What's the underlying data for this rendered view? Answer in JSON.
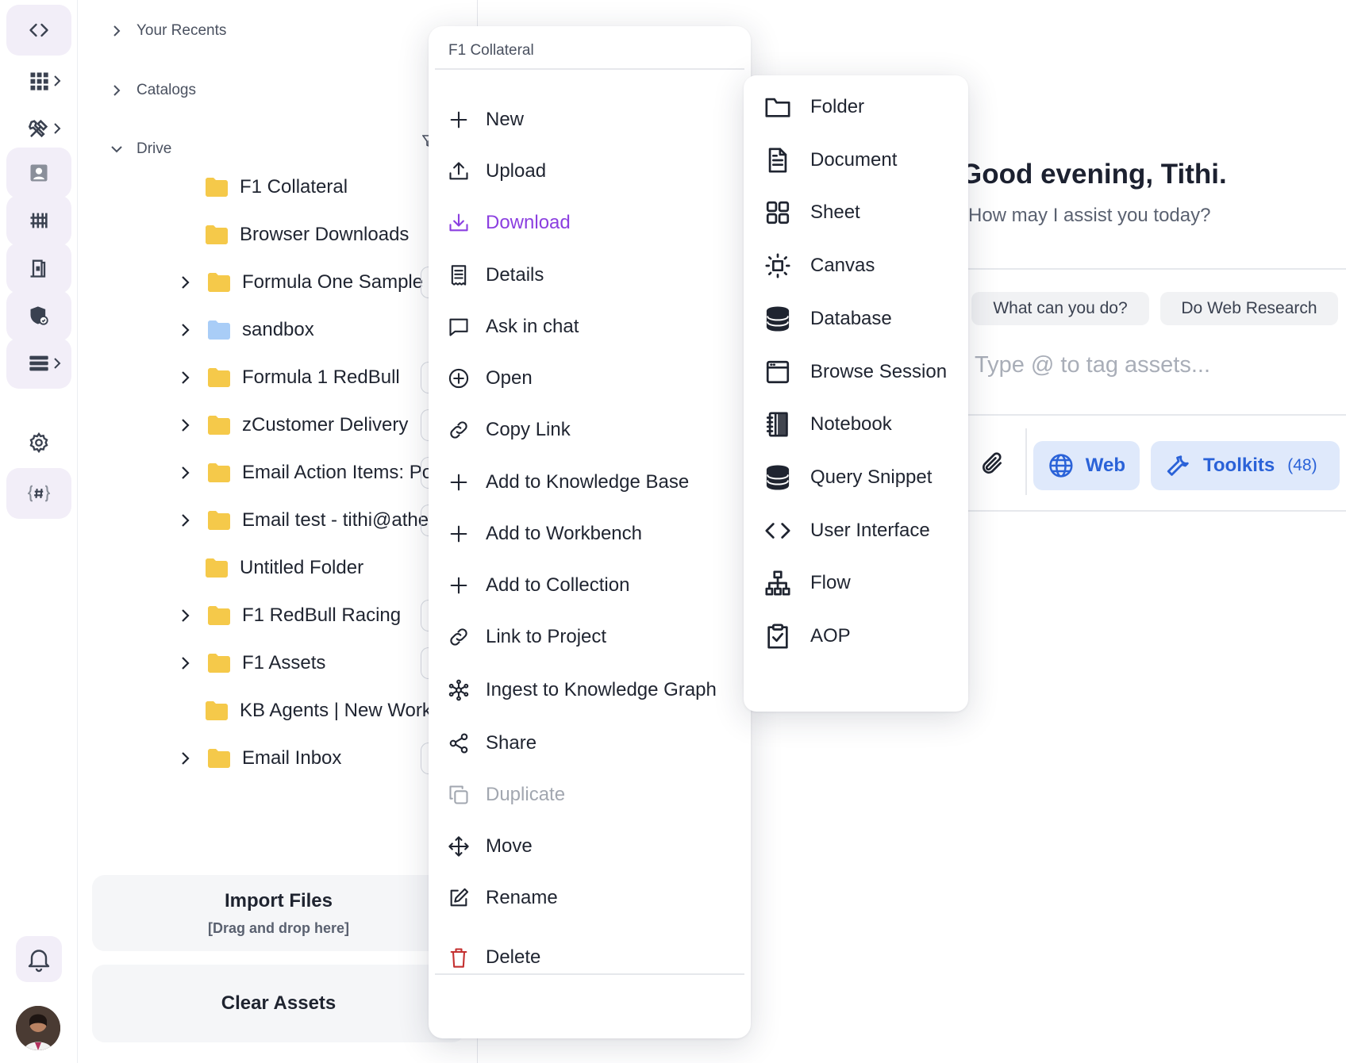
{
  "sidebar": {
    "sections": {
      "recents": "Your Recents",
      "catalogs": "Catalogs",
      "drive": "Drive"
    },
    "tree": [
      {
        "label": "F1 Collateral",
        "expandable": false,
        "color": "#f5c94a"
      },
      {
        "label": "Browser Downloads",
        "expandable": false,
        "color": "#f5c94a"
      },
      {
        "label": "Formula One Sample Da...",
        "expandable": true,
        "color": "#f5c94a"
      },
      {
        "label": "sandbox",
        "expandable": true,
        "color": "#a9cdf7"
      },
      {
        "label": "Formula 1 RedBull",
        "expandable": true,
        "color": "#f5c94a"
      },
      {
        "label": "zCustomer Delivery",
        "expandable": true,
        "color": "#f5c94a"
      },
      {
        "label": "Email Action Items: Post...",
        "expandable": true,
        "color": "#f5c94a"
      },
      {
        "label": "Email test - tithi@athena...",
        "expandable": true,
        "color": "#f5c94a"
      },
      {
        "label": "Untitled Folder",
        "expandable": false,
        "color": "#f5c94a"
      },
      {
        "label": "F1 RedBull Racing",
        "expandable": true,
        "color": "#f5c94a"
      },
      {
        "label": "F1 Assets",
        "expandable": true,
        "color": "#f5c94a"
      },
      {
        "label": "KB Agents | New Workspa...",
        "expandable": false,
        "color": "#f5c94a"
      },
      {
        "label": "Email Inbox",
        "expandable": true,
        "color": "#f5c94a"
      }
    ],
    "import_title": "Import Files",
    "import_hint": "[Drag and drop here]",
    "clear_label": "Clear Assets"
  },
  "context_menu": {
    "title": "F1 Collateral",
    "items": [
      {
        "label": "New",
        "icon": "plus-icon"
      },
      {
        "label": "Upload",
        "icon": "upload-icon"
      },
      {
        "label": "Download",
        "icon": "download-icon"
      },
      {
        "label": "Details",
        "icon": "receipt-icon"
      },
      {
        "label": "Ask in chat",
        "icon": "chat-bubble-icon"
      },
      {
        "label": "Open",
        "icon": "plus-circle-icon"
      },
      {
        "label": "Copy Link",
        "icon": "link-icon"
      },
      {
        "label": "Add to Knowledge Base",
        "icon": "plus-icon"
      },
      {
        "label": "Add to Workbench",
        "icon": "plus-icon"
      },
      {
        "label": "Add to Collection",
        "icon": "plus-icon"
      },
      {
        "label": "Link to Project",
        "icon": "link-icon"
      },
      {
        "label": "Ingest to Knowledge Graph",
        "icon": "graph-icon"
      },
      {
        "label": "Share",
        "icon": "share-icon"
      },
      {
        "label": "Duplicate",
        "icon": "duplicate-icon"
      },
      {
        "label": "Move",
        "icon": "move-icon"
      },
      {
        "label": "Rename",
        "icon": "edit-icon"
      },
      {
        "label": "Delete",
        "icon": "trash-icon"
      }
    ]
  },
  "new_submenu": {
    "items": [
      {
        "label": "Folder",
        "icon": "folder-icon"
      },
      {
        "label": "Document",
        "icon": "document-icon"
      },
      {
        "label": "Sheet",
        "icon": "sheet-icon"
      },
      {
        "label": "Canvas",
        "icon": "canvas-icon"
      },
      {
        "label": "Database",
        "icon": "database-icon"
      },
      {
        "label": "Browse Session",
        "icon": "browser-icon"
      },
      {
        "label": "Notebook",
        "icon": "notebook-icon"
      },
      {
        "label": "Query Snippet",
        "icon": "database-icon"
      },
      {
        "label": "User Interface",
        "icon": "code-icon"
      },
      {
        "label": "Flow",
        "icon": "flow-icon"
      },
      {
        "label": "AOP",
        "icon": "clipboard-check-icon"
      }
    ]
  },
  "chat": {
    "greeting": "Good evening, Tithi.",
    "subtitle": "How may I assist you today?",
    "suggestions": [
      "What can you do?",
      "Do Web Research"
    ],
    "placeholder": "Type @ to tag assets...",
    "web_label": "Web",
    "toolkits_label": "Toolkits",
    "toolkits_count": "(48)"
  },
  "colors": {
    "accent_purple": "#8b3fe0",
    "accent_blue": "#2a62d8",
    "danger": "#c43030",
    "folder_yellow": "#f5c94a",
    "folder_blue": "#a9cdf7"
  }
}
